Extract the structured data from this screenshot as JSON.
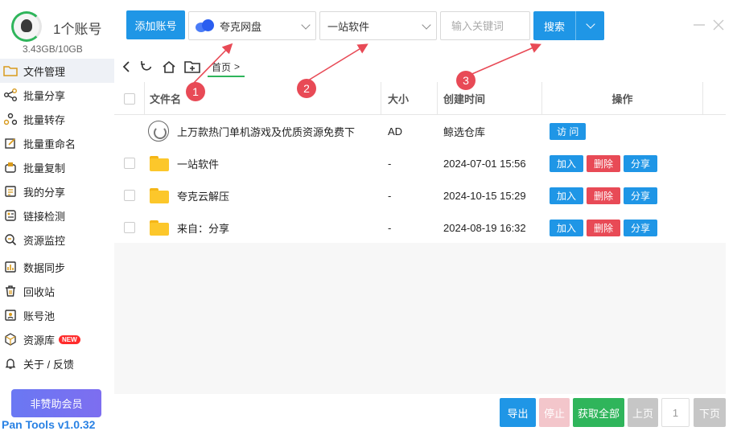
{
  "sidebar": {
    "account_count": "1个账号",
    "storage": "3.43GB/10GB",
    "items": [
      {
        "label": "文件管理",
        "icon": "folder-icon"
      },
      {
        "label": "批量分享",
        "icon": "share-icon"
      },
      {
        "label": "批量转存",
        "icon": "transfer-icon"
      },
      {
        "label": "批量重命名",
        "icon": "rename-icon"
      },
      {
        "label": "批量复制",
        "icon": "copy-icon"
      },
      {
        "label": "我的分享",
        "icon": "my-share-icon"
      },
      {
        "label": "链接检测",
        "icon": "link-check-icon"
      },
      {
        "label": "资源监控",
        "icon": "monitor-icon"
      },
      {
        "label": "数据同步",
        "icon": "sync-icon"
      },
      {
        "label": "回收站",
        "icon": "trash-icon"
      },
      {
        "label": "账号池",
        "icon": "account-pool-icon"
      },
      {
        "label": "资源库",
        "icon": "library-icon",
        "badge": "NEW"
      },
      {
        "label": "关于 / 反馈",
        "icon": "bell-icon"
      }
    ],
    "sponsor_button": "非赞助会员",
    "version": "Pan Tools v1.0.32"
  },
  "topbar": {
    "add_account": "添加账号",
    "drive_select": "夸克网盘",
    "folder_select": "一站软件",
    "keyword_placeholder": "输入关键词",
    "search_button": "搜索"
  },
  "breadcrumb": {
    "home": "首页",
    "separator": ">"
  },
  "table": {
    "headers": {
      "name": "文件名",
      "size": "大小",
      "created": "创建时间",
      "ops": "操作"
    },
    "rows": [
      {
        "name": "上万款热门单机游戏及优质资源免费下",
        "size": "AD",
        "created": "鲸选仓库",
        "kind": "ad",
        "ops": [
          "访 问"
        ]
      },
      {
        "name": "一站软件",
        "size": "-",
        "created": "2024-07-01 15:56",
        "kind": "folder",
        "ops": [
          "加入",
          "删除",
          "分享"
        ]
      },
      {
        "name": "夸克云解压",
        "size": "-",
        "created": "2024-10-15 15:29",
        "kind": "folder",
        "ops": [
          "加入",
          "删除",
          "分享"
        ]
      },
      {
        "name": "来自：分享",
        "size": "-",
        "created": "2024-08-19 16:32",
        "kind": "folder",
        "ops": [
          "加入",
          "删除",
          "分享"
        ]
      }
    ]
  },
  "annotations": [
    "1",
    "2",
    "3"
  ],
  "pagination": {
    "export": "导出",
    "stop": "停止",
    "fetch_all": "获取全部",
    "prev": "上页",
    "page": "1",
    "next": "下页"
  },
  "colors": {
    "primary": "#1f96e6",
    "danger": "#e84a56",
    "success": "#2fb55b",
    "annotation": "#e84a56"
  }
}
